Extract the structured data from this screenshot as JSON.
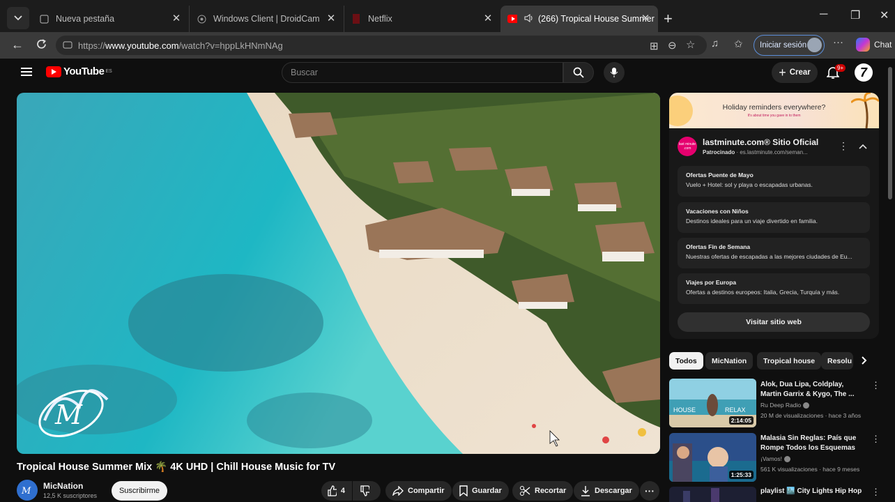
{
  "browser": {
    "tabs": [
      {
        "label": "Nueva pestaña",
        "icon": "new-tab-page-icon"
      },
      {
        "label": "Windows Client | DroidCam",
        "icon": "droidcam-icon"
      },
      {
        "label": "Netflix",
        "icon": "netflix-icon"
      },
      {
        "label": "(266) Tropical House Summer",
        "icon": "youtube-icon",
        "active": true
      }
    ],
    "url_prefix": "https://",
    "url_host": "www.youtube.com",
    "url_path": "/watch?v=hppLkHNmNAg",
    "signin_label": "Iniciar sesión",
    "chat_label": "Chat"
  },
  "youtube": {
    "logo_text": "YouTube",
    "region": "ES",
    "search_placeholder": "Buscar",
    "create_label": "Crear",
    "notif_count": "9+",
    "video": {
      "title": "Tropical House Summer Mix 🌴 4K UHD | Chill House Music for TV",
      "channel": "MicNation",
      "subscribers": "12,5 K suscriptores",
      "subscribe_label": "Suscribirme",
      "likes": "4",
      "share_label": "Compartir",
      "save_label": "Guardar",
      "clip_label": "Recortar",
      "download_label": "Descargar"
    },
    "ad": {
      "banner_text": "Holiday reminders everywhere?",
      "banner_sub": "It's about time you gave in to them",
      "logo_text": "last minute .com",
      "name": "lastminute.com® Sitio Oficial",
      "sponsored": "Patrocinado",
      "domain": "· es.lastminute.com/seman...",
      "items": [
        {
          "title": "Ofertas Puente de Mayo",
          "desc": "Vuelo + Hotel: sol y playa o escapadas urbanas."
        },
        {
          "title": "Vacaciones con Niños",
          "desc": "Destinos ideales para un viaje divertido en familia."
        },
        {
          "title": "Ofertas Fin de Semana",
          "desc": "Nuestras ofertas de escapadas a las mejores ciudades de Eu..."
        },
        {
          "title": "Viajes por Europa",
          "desc": "Ofertas a destinos europeos: Italia, Grecia, Turquía y más."
        }
      ],
      "visit_label": "Visitar sitio web"
    },
    "chips": [
      "Todos",
      "MicNation",
      "Tropical house",
      "Resolu"
    ],
    "recommendations": [
      {
        "title": "Alok, Dua Lipa, Coldplay, Martin Garrix & Kygo, The ...",
        "channel": "Ru Deep Radio",
        "meta": "20 M de visualizaciones · hace 3 años",
        "duration": "2:14:05",
        "thumb_text_left": "HOUSE",
        "thumb_text_right": "RELAX"
      },
      {
        "title": "Malasia Sin Reglas: País que Rompe Todos los Esquemas",
        "channel": "¡Vamos!",
        "meta": "561 K visualizaciones · hace 9 meses",
        "duration": "1:25:33"
      },
      {
        "title": "playlist 🏙️ City Lights Hip Hop"
      }
    ]
  },
  "colors": {
    "yt_red": "#ff0000",
    "accent_blue": "#5b8dd8",
    "ad_pink": "#e5006e"
  }
}
